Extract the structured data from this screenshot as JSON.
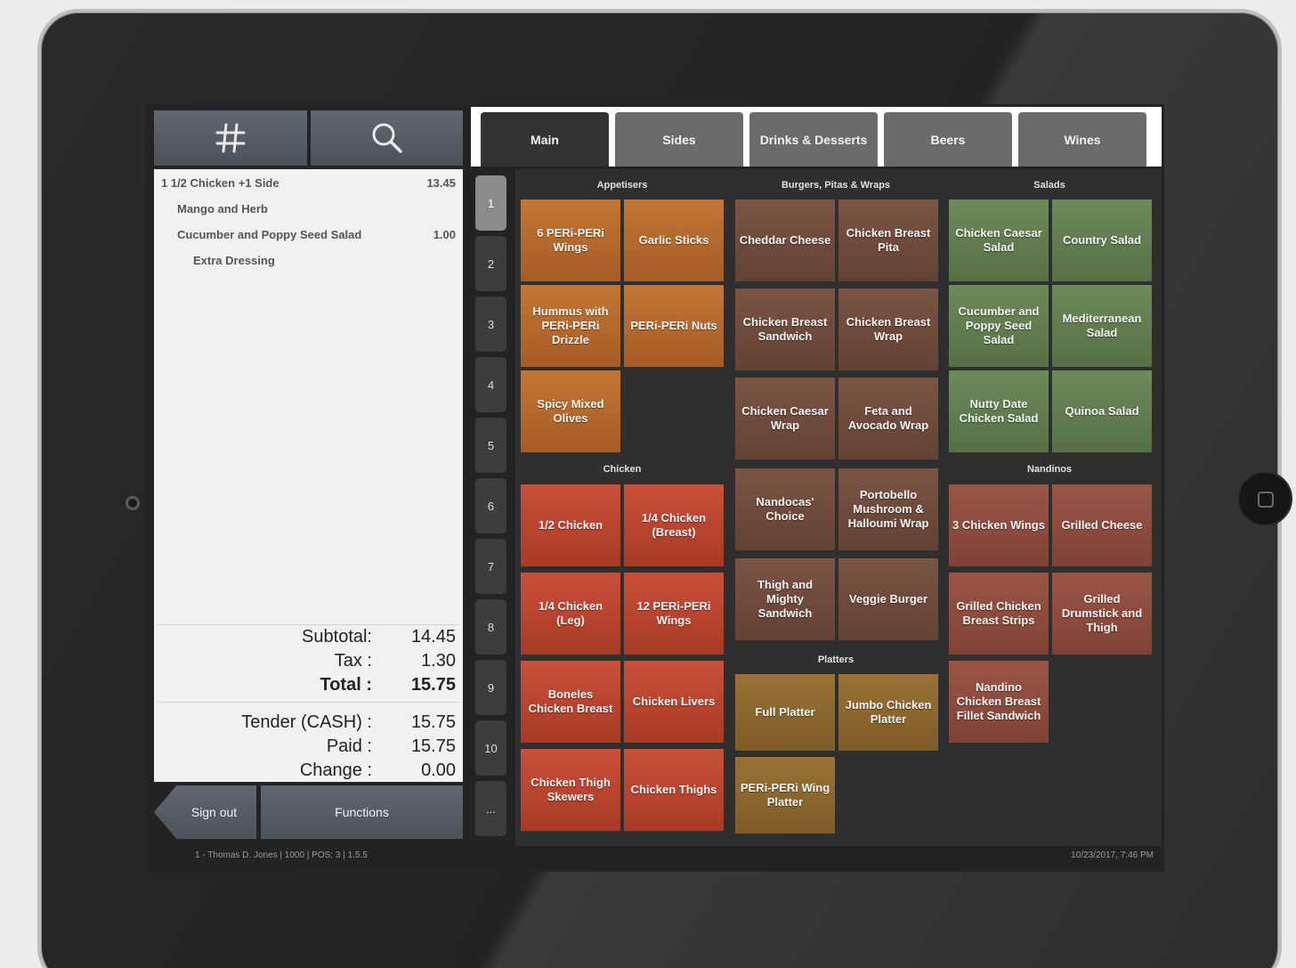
{
  "toolbar": {
    "hash_icon": "hash-icon",
    "search_icon": "search-icon"
  },
  "order": {
    "lines": [
      {
        "text": "1 1/2 Chicken +1 Side",
        "price": "13.45"
      },
      {
        "text": "Mango and Herb",
        "price": ""
      },
      {
        "text": "Cucumber and Poppy Seed Salad",
        "price": "1.00"
      },
      {
        "text": "Extra Dressing",
        "price": ""
      }
    ],
    "subtotal_label": "Subtotal:",
    "subtotal": "14.45",
    "tax_label": "Tax :",
    "tax": "1.30",
    "total_label": "Total :",
    "total": "15.75",
    "tender_label": "Tender (CASH) :",
    "tender": "15.75",
    "paid_label": "Paid :",
    "paid": "15.75",
    "change_label": "Change :",
    "change": "0.00"
  },
  "buttons": {
    "sign_out": "Sign out",
    "functions": "Functions"
  },
  "tabs": [
    "Main",
    "Sides",
    "Drinks & Desserts",
    "Beers",
    "Wines"
  ],
  "pages": [
    "1",
    "2",
    "3",
    "4",
    "5",
    "6",
    "7",
    "8",
    "9",
    "10",
    "..."
  ],
  "sections": {
    "appetisers": "Appetisers",
    "burgers": "Burgers, Pitas & Wraps",
    "salads": "Salads",
    "chicken": "Chicken",
    "nandinos": "Nandinos",
    "platters": "Platters"
  },
  "items": {
    "appetisers": [
      "6 PERi-PERi Wings",
      "Garlic Sticks",
      "Hummus with PERi-PERi Drizzle",
      "PERi-PERi Nuts",
      "Spicy Mixed Olives"
    ],
    "chicken": [
      "1/2 Chicken",
      "1/4 Chicken (Breast)",
      "1/4 Chicken (Leg)",
      "12 PERi-PERi Wings",
      "Boneles Chicken Breast",
      "Chicken Livers",
      "Chicken Thigh Skewers",
      "Chicken Thighs"
    ],
    "burgers": [
      "Cheddar Cheese",
      "Chicken Breast Pita",
      "Chicken Breast Sandwich",
      "Chicken Breast Wrap",
      "Chicken Caesar Wrap",
      "Feta and Avocado Wrap",
      "Nandocas' Choice",
      "Portobello Mushroom & Halloumi Wrap",
      "Thigh and Mighty Sandwich",
      "Veggie Burger"
    ],
    "platters": [
      "Full Platter",
      "Jumbo Chicken Platter",
      "PERi-PERi Wing Platter"
    ],
    "salads": [
      "Chicken Caesar Salad",
      "Country Salad",
      "Cucumber and Poppy Seed Salad",
      "Mediterranean Salad",
      "Nutty Date Chicken Salad",
      "Quinoa Salad"
    ],
    "nandinos": [
      "3 Chicken Wings",
      "Grilled Cheese",
      "Grilled Chicken Breast Strips",
      "Grilled Drumstick and Thigh",
      "Nandino Chicken Breast Fillet Sandwich"
    ]
  },
  "status": {
    "left": "1 - Thomas D. Jones | 1000 | POS: 3 | 1.5.5",
    "right": "10/23/2017, 7:46 PM"
  },
  "colors": {
    "appetisers": "#b56a2e",
    "chicken": "#bb4530",
    "burgers": "#70493b",
    "platters": "#8e692f",
    "salads": "#627d50",
    "nandinos": "#8d4b3e"
  }
}
